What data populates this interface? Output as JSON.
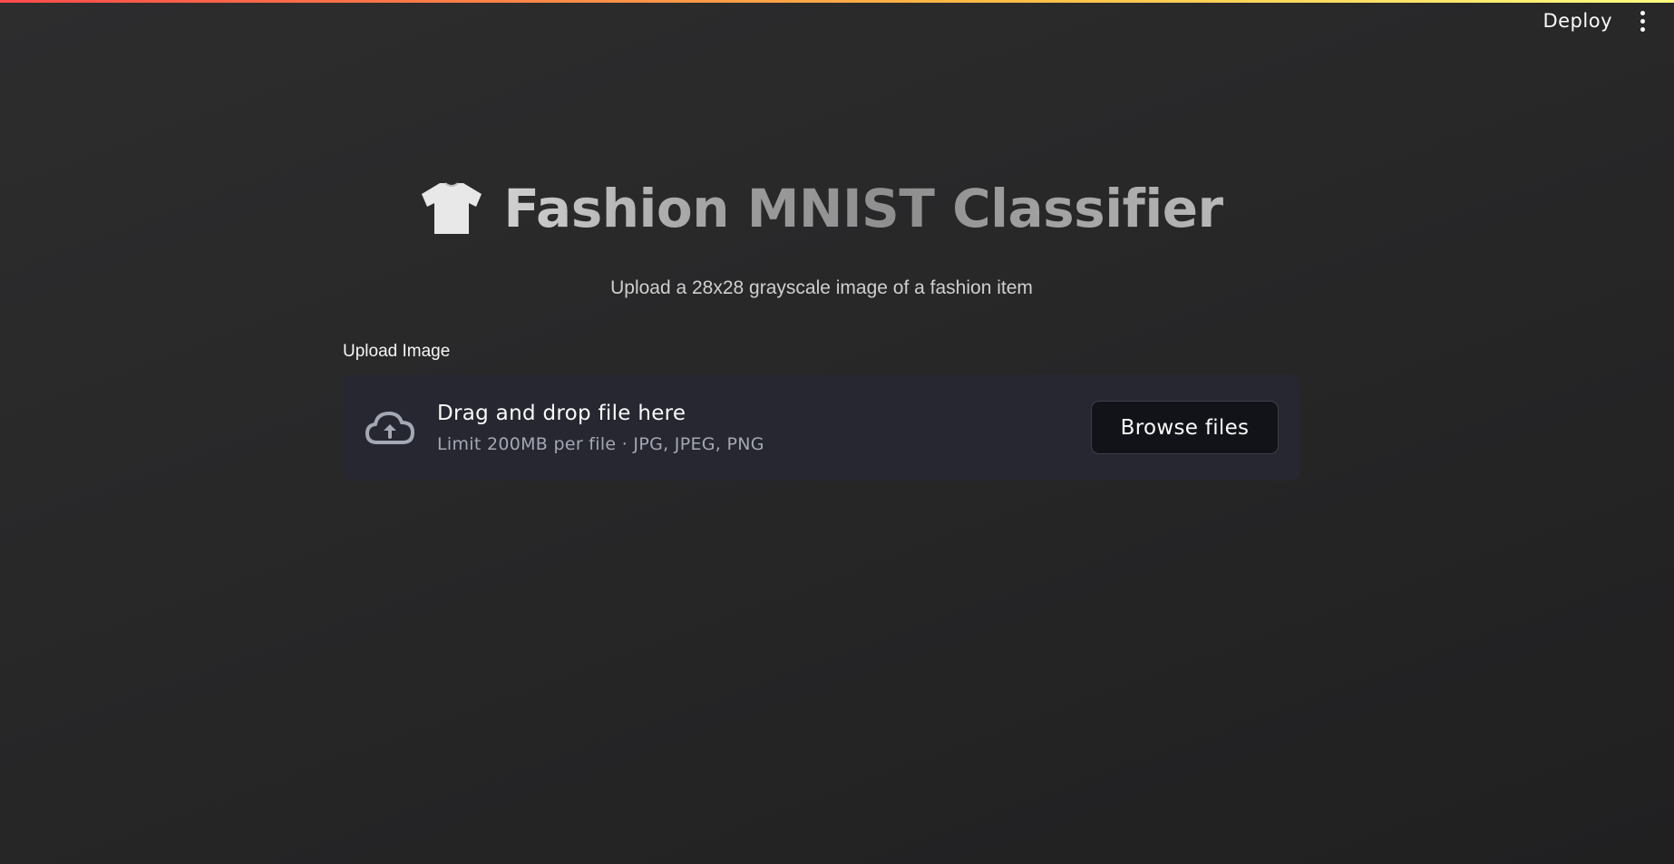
{
  "header": {
    "deploy_label": "Deploy",
    "menu_icon": "vertical-dots-icon"
  },
  "main": {
    "title_icon": "tshirt-icon",
    "title": "Fashion MNIST Classifier",
    "subtitle": "Upload a 28x28 grayscale image of a fashion item",
    "uploader": {
      "label": "Upload Image",
      "icon": "cloud-upload-icon",
      "drop_text": "Drag and drop file here",
      "limit_text": "Limit 200MB per file · JPG, JPEG, PNG",
      "browse_label": "Browse files"
    }
  },
  "colors": {
    "background": "#282829",
    "dropzone": "#262730",
    "stripe_start": "#ff4b4b",
    "stripe_end": "#fffd80"
  }
}
